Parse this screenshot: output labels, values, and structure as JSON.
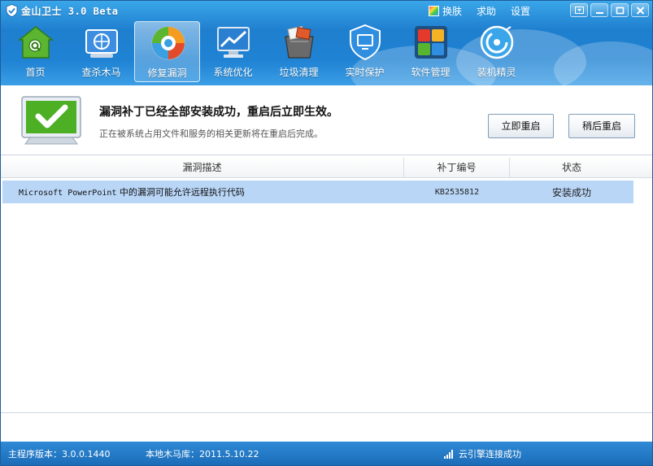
{
  "app": {
    "title": "金山卫士 3.0 Beta",
    "title_links": [
      "换肤",
      "求助",
      "设置"
    ]
  },
  "nav": {
    "items": [
      {
        "label": "首页",
        "icon": "home-icon",
        "active": false
      },
      {
        "label": "查杀木马",
        "icon": "trojan-scan-icon",
        "active": false
      },
      {
        "label": "修复漏洞",
        "icon": "patch-repair-icon",
        "active": true
      },
      {
        "label": "系统优化",
        "icon": "system-optimize-icon",
        "active": false
      },
      {
        "label": "垃圾清理",
        "icon": "junk-clean-icon",
        "active": false
      },
      {
        "label": "实时保护",
        "icon": "realtime-protect-icon",
        "active": false
      },
      {
        "label": "软件管理",
        "icon": "software-manage-icon",
        "active": false
      },
      {
        "label": "装机精灵",
        "icon": "install-wizard-icon",
        "active": false
      }
    ]
  },
  "banner": {
    "title": "漏洞补丁已经全部安装成功，重启后立即生效。",
    "subtitle": "正在被系统占用文件和服务的相关更新将在重启后完成。",
    "restart_now": "立即重启",
    "restart_later": "稍后重启"
  },
  "table": {
    "headers": [
      "漏洞描述",
      "补丁编号",
      "状态"
    ],
    "rows": [
      {
        "desc_prefix": "Microsoft PowerPoint",
        "desc_suffix": " 中的漏洞可能允许远程执行代码",
        "kb": "KB2535812",
        "status": "安装成功"
      }
    ]
  },
  "statusbar": {
    "version": "主程序版本：3.0.0.1440",
    "trojan_db": "本地木马库：2011.5.10.22",
    "cloud": "云引擎连接成功"
  },
  "colors": {
    "header_blue": "#1f7fcf",
    "selected_row": "#b9d6f7",
    "success_green": "#4caf24"
  }
}
